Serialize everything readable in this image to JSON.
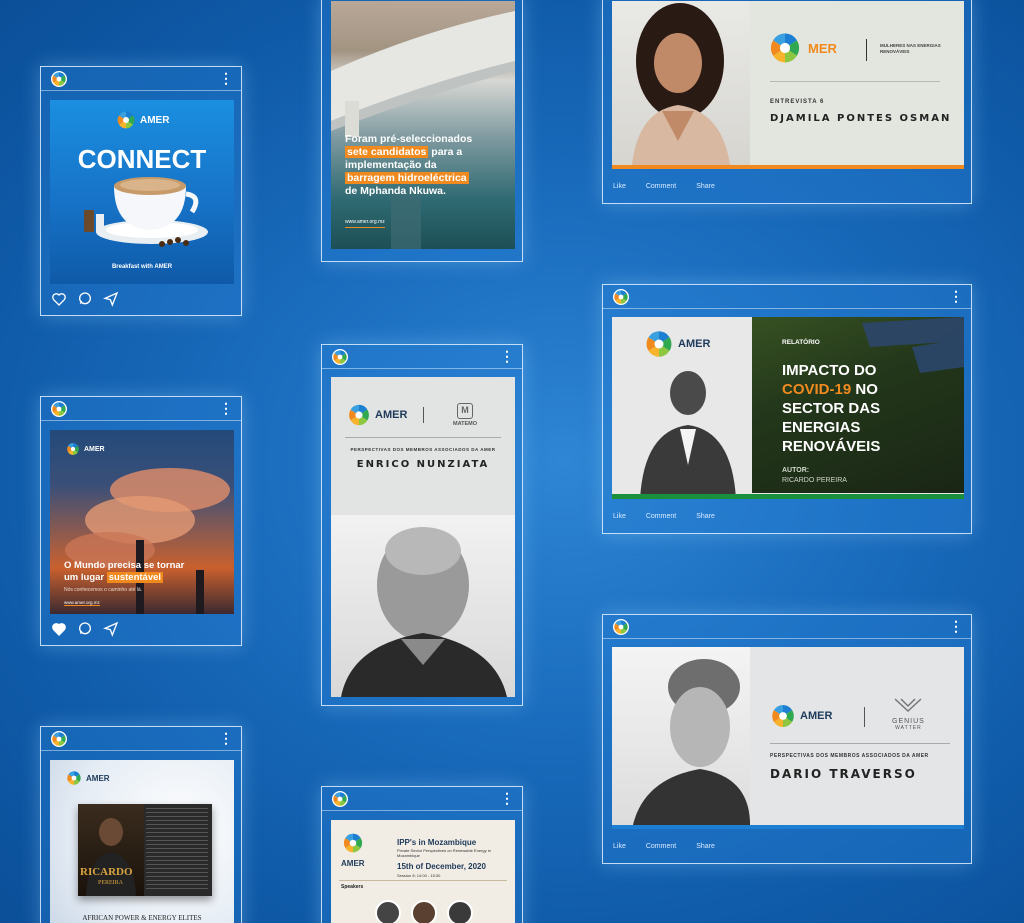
{
  "colors": {
    "brand_orange": "#f08a1f",
    "brand_blue": "#1c7fd1",
    "brand_green": "#1a8f3c",
    "background": "#1a6cbd"
  },
  "icons": {
    "card_logo": "amer-logo-icon",
    "menu": "kebab-menu-icon",
    "like": "heart-icon",
    "comment": "comment-bubble-icon",
    "share": "paper-plane-icon"
  },
  "card_menu_glyph": "⋮",
  "actions": {
    "like": "Like",
    "comment": "Comment",
    "share": "Share"
  },
  "posts": {
    "connect": {
      "brand": "AMER",
      "title": "CONNECT",
      "caption": "Breakfast with AMER"
    },
    "dam": {
      "line1": "Foram pré-seleccionados",
      "highlight1": "sete candidatos",
      "line2": "para a",
      "line3": "implementação da",
      "highlight2": "barragem hidroeléctrica",
      "line4": "de Mphanda Nkuwa.",
      "url": "www.amer.org.mz"
    },
    "djamila": {
      "brand": "MER",
      "tagline": "MULHERES NAS ENERGIAS RENOVÁVEIS",
      "interview": "ENTREVISTA 6",
      "name": "DJAMILA PONTES OSMAN"
    },
    "sustain": {
      "brand": "AMER",
      "line1": "O Mundo precisa se tornar",
      "line2a": "um lugar",
      "highlight": "sustentável",
      "subline": "Nós conhecemos o caminho até lá.",
      "url": "www.amer.org.mz"
    },
    "enrico": {
      "brand": "AMER",
      "partner": "MATEMO",
      "subtitle": "PERSPECTIVAS DOS MEMBROS ASSOCIADOS DA AMER",
      "name": "ENRICO NUNZIATA"
    },
    "covid": {
      "brand": "AMER",
      "label": "RELATÓRIO",
      "title1": "IMPACTO DO",
      "title_highlight": "COVID-19",
      "title2": "NO",
      "title3": "SECTOR DAS",
      "title4": "ENERGIAS",
      "title5": "RENOVÁVEIS",
      "author_label": "AUTOR:",
      "author": "RICARDO PEREIRA"
    },
    "dario": {
      "brand": "AMER",
      "partner": "GENIUS",
      "partner2": "WATTER",
      "subtitle": "PERSPECTIVAS DOS MEMBROS ASSOCIADOS DA AMER",
      "name": "DARIO TRAVERSO"
    },
    "magazine": {
      "brand": "AMER",
      "cover_name": "RICARDO",
      "cover_surname": "PEREIRA",
      "footer": "AFRICAN POWER & ENERGY ELITES"
    },
    "ipp": {
      "brand": "AMER",
      "title": "IPP's in Mozambique",
      "subtitle": "Private Sector Perspectives on Renewable Energy in Mozambique",
      "date": "15th of December, 2020",
      "session": "Session 8: 14:00 - 15:30",
      "speakers_label": "Speakers"
    }
  }
}
